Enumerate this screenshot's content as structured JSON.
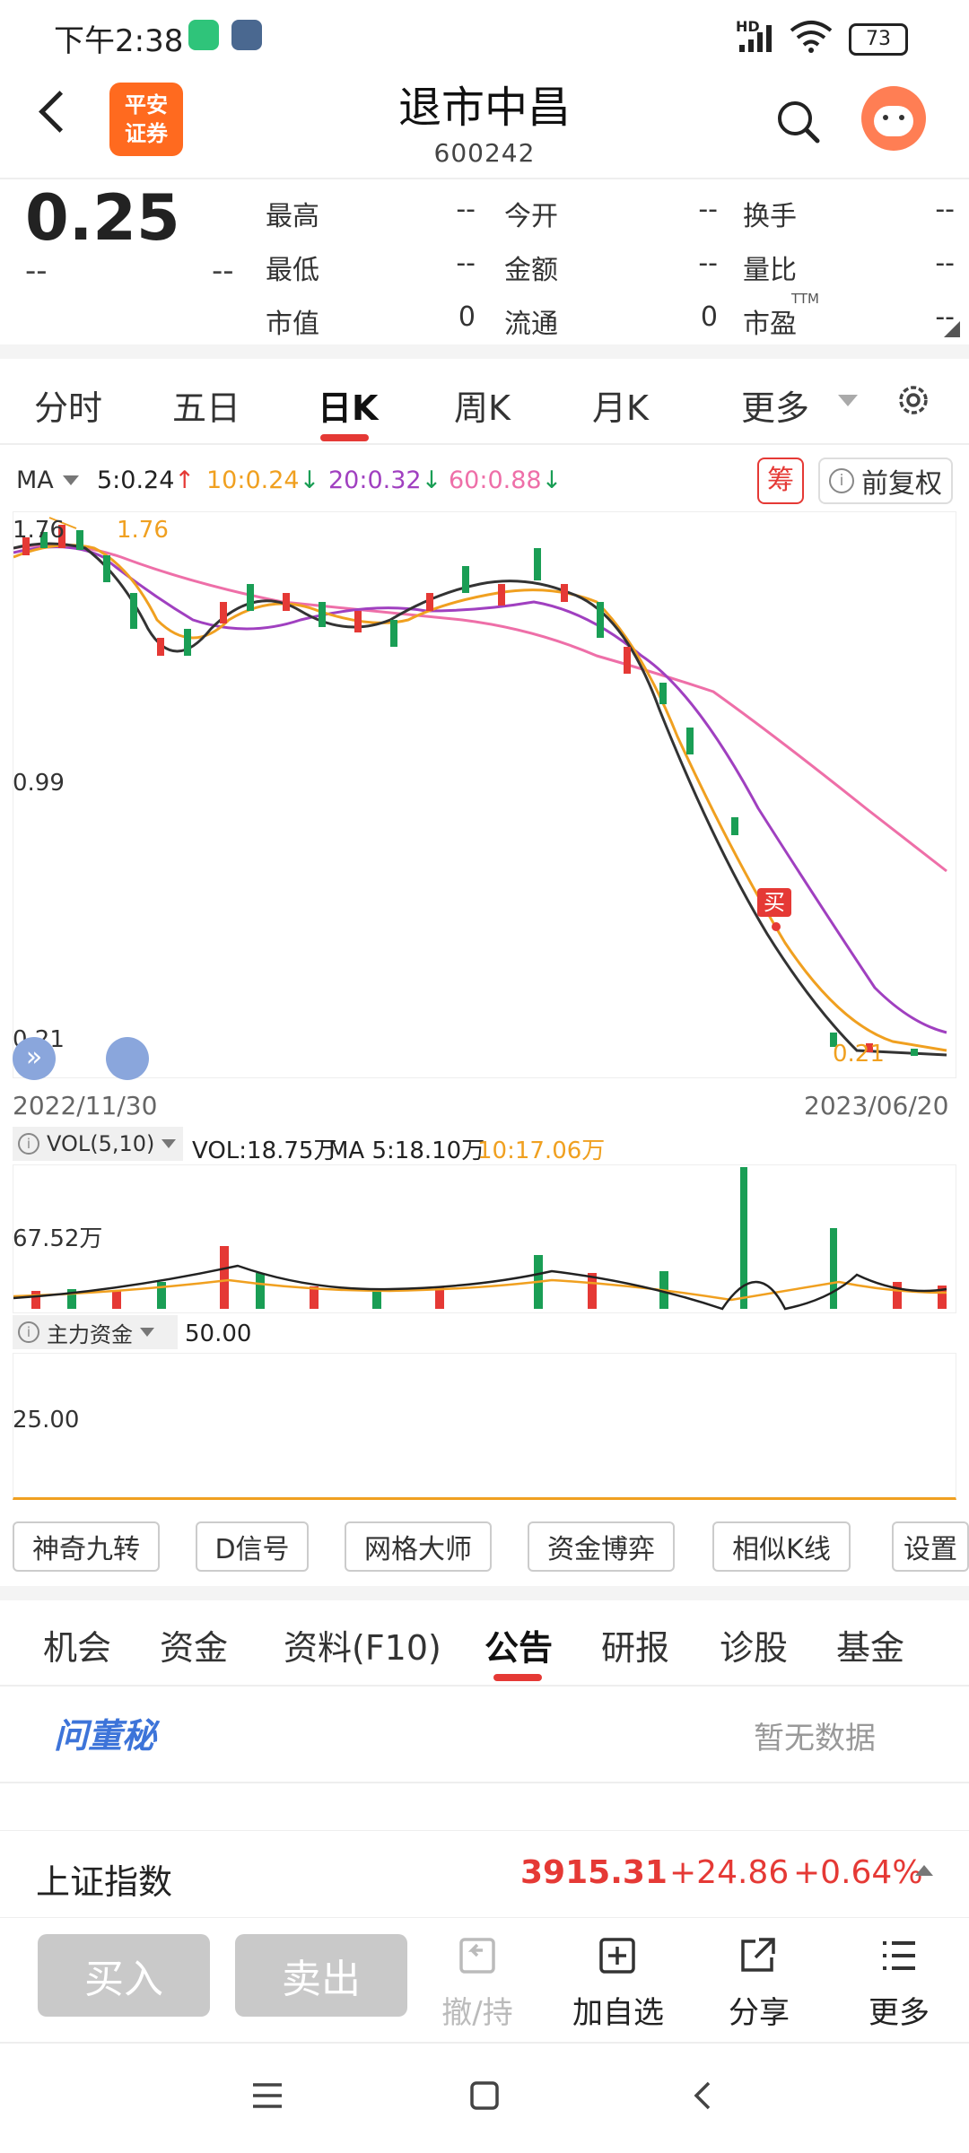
{
  "status_bar": {
    "time": "下午2:38",
    "network": "HD",
    "battery": "73"
  },
  "header": {
    "logo_line1": "平安",
    "logo_line2": "证券",
    "title": "退市中昌",
    "code": "600242"
  },
  "quote": {
    "price": "0.25",
    "change": "--",
    "change_pct": "--",
    "fields": [
      {
        "label": "最高",
        "value": "--"
      },
      {
        "label": "今开",
        "value": "--"
      },
      {
        "label": "换手",
        "value": "--"
      },
      {
        "label": "最低",
        "value": "--"
      },
      {
        "label": "金额",
        "value": "--"
      },
      {
        "label": "量比",
        "value": "--"
      },
      {
        "label": "市值",
        "value": "0"
      },
      {
        "label": "流通",
        "value": "0"
      },
      {
        "label": "市盈",
        "value": "--"
      }
    ],
    "ttm": "TTM"
  },
  "chart_tabs": [
    "分时",
    "五日",
    "日K",
    "周K",
    "月K",
    "更多"
  ],
  "active_tab": "日K",
  "ma_legend": {
    "label": "MA",
    "items": [
      {
        "text": "5:0.24",
        "arrow": "↑",
        "color": "#222222",
        "arrow_color": "#e53935"
      },
      {
        "text": "10:0.24",
        "arrow": "↓",
        "color": "#f0a020",
        "arrow_color": "#1a9e55"
      },
      {
        "text": "20:0.32",
        "arrow": "↓",
        "color": "#a040c0",
        "arrow_color": "#1a9e55"
      },
      {
        "text": "60:0.88",
        "arrow": "↓",
        "color": "#ee6fa8",
        "arrow_color": "#1a9e55"
      }
    ],
    "chip_button": "筹",
    "adjust_button": "前复权"
  },
  "kline": {
    "y_labels": [
      "1.76",
      "0.99",
      "0.21"
    ],
    "max_marker": "1.76",
    "min_marker": "0.21",
    "buy_marker": "买",
    "start_date": "2022/11/30",
    "end_date": "2023/06/20"
  },
  "volume": {
    "indicator": "VOL(5,10)",
    "vol": "VOL:18.75万",
    "ma5": "MA 5:18.10万",
    "ma10": "10:17.06万",
    "y_label": "67.52万"
  },
  "capital": {
    "indicator": "主力资金",
    "value": "50.00",
    "y_label": "25.00"
  },
  "tools": [
    "神奇九转",
    "D信号",
    "网格大师",
    "资金博弈",
    "相似K线",
    "设置"
  ],
  "info_tabs": [
    "机会",
    "资金",
    "资料(F10)",
    "公告",
    "研报",
    "诊股",
    "基金"
  ],
  "active_info_tab": "公告",
  "dongmi": {
    "logo": "问董秘",
    "empty": "暂无数据"
  },
  "index_bar": {
    "name": "上证指数",
    "value": "3915.31",
    "change": "+24.86",
    "pct": "+0.64%"
  },
  "bottom_bar": {
    "buy": "买入",
    "sell": "卖出",
    "actions": [
      {
        "label": "撤/持",
        "icon": "cancel-hold-icon"
      },
      {
        "label": "加自选",
        "icon": "add-watchlist-icon"
      },
      {
        "label": "分享",
        "icon": "share-icon"
      },
      {
        "label": "更多",
        "icon": "more-list-icon"
      }
    ]
  },
  "colors": {
    "up": "#e53935",
    "down": "#1a9e55",
    "accent": "#e53935"
  }
}
